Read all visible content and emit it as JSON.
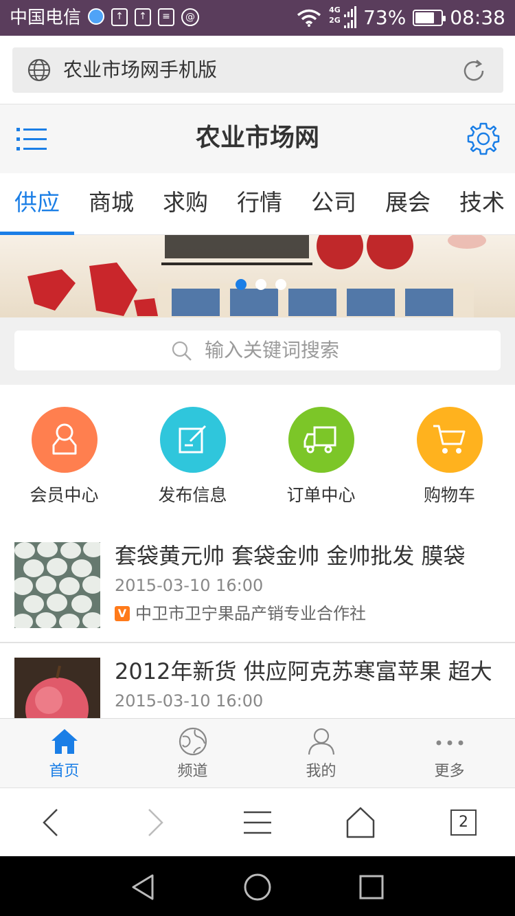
{
  "status_bar": {
    "carrier": "中国电信",
    "network_top": "4G",
    "network_bottom": "2G",
    "battery": "73%",
    "battery_level": 0.73,
    "time": "08:38"
  },
  "browser": {
    "url_title": "农业市场网手机版",
    "tab_count": "2"
  },
  "header": {
    "title": "农业市场网"
  },
  "tabs": [
    {
      "label": "供应",
      "active": true
    },
    {
      "label": "商城",
      "active": false
    },
    {
      "label": "求购",
      "active": false
    },
    {
      "label": "行情",
      "active": false
    },
    {
      "label": "公司",
      "active": false
    },
    {
      "label": "展会",
      "active": false
    },
    {
      "label": "技术",
      "active": false
    }
  ],
  "banner": {
    "slide_count": 3,
    "active_slide": 1
  },
  "search": {
    "placeholder": "输入关键词搜索"
  },
  "quick_links": [
    {
      "label": "会员中心",
      "icon": "user-icon",
      "color": "#ff7f4f"
    },
    {
      "label": "发布信息",
      "icon": "edit-icon",
      "color": "#2fc6dc"
    },
    {
      "label": "订单中心",
      "icon": "truck-icon",
      "color": "#7cc628"
    },
    {
      "label": "购物车",
      "icon": "cart-icon",
      "color": "#ffb21e"
    }
  ],
  "listings": [
    {
      "title": "套袋黄元帅 套袋金帅 金帅批发 膜袋",
      "date": "2015-03-10 16:00",
      "company": "中卫市卫宁果品产销专业合作社",
      "verified_badge": "V"
    },
    {
      "title": "2012年新货 供应阿克苏寒富苹果 超大",
      "date": "2015-03-10 16:00"
    }
  ],
  "bottom_nav": [
    {
      "label": "首页",
      "icon": "home-icon",
      "active": true
    },
    {
      "label": "频道",
      "icon": "globe-icon",
      "active": false
    },
    {
      "label": "我的",
      "icon": "person-icon",
      "active": false
    },
    {
      "label": "更多",
      "icon": "more-icon",
      "active": false
    }
  ],
  "colors": {
    "accent": "#1a7ee6",
    "status_bar": "#5a3d5c"
  }
}
